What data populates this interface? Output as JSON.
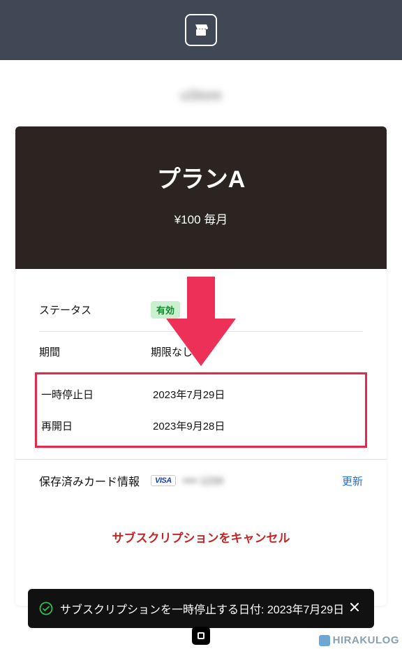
{
  "header": {
    "blurred_brand": "uStore"
  },
  "plan": {
    "title": "プランA",
    "price_line": "¥100 毎月"
  },
  "details": {
    "status_label": "ステータス",
    "status_badge": "有効",
    "period_label": "期間",
    "period_value": "期限なし",
    "pause_label": "一時停止日",
    "pause_value": "2023年7月29日",
    "resume_label": "再開日",
    "resume_value": "2023年9月28日"
  },
  "card_info": {
    "label": "保存済みカード情報",
    "brand": "VISA",
    "masked": "•••• 1234",
    "update_link": "更新"
  },
  "actions": {
    "cancel_label": "サブスクリプションをキャンセル"
  },
  "toast": {
    "message": "サブスクリプションを一時停止する日付: 2023年7月29日"
  },
  "watermark": {
    "text": "HIRAKULOG"
  }
}
